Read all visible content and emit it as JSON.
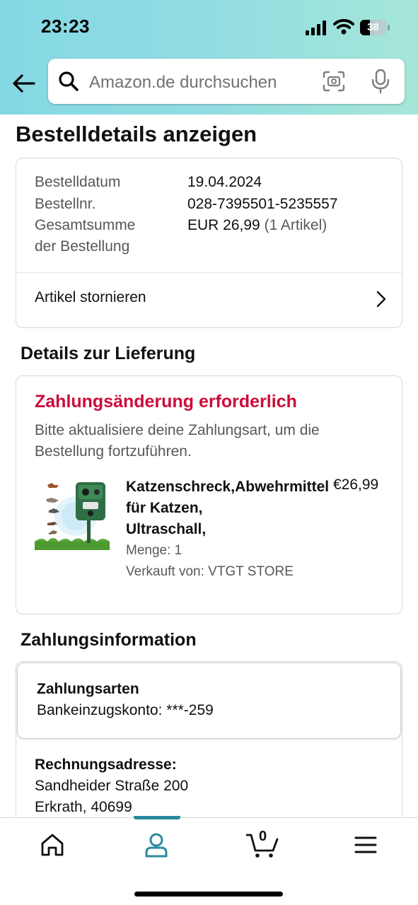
{
  "status_bar": {
    "time": "23:23",
    "battery": "38",
    "battery_level": 0.38
  },
  "search": {
    "placeholder": "Amazon.de durchsuchen"
  },
  "page": {
    "title": "Bestelldetails anzeigen"
  },
  "order_summary": {
    "rows": [
      {
        "label": "Bestelldatum",
        "value": "19.04.2024"
      },
      {
        "label": "Bestellnr.",
        "value": "028-7395501-5235557"
      },
      {
        "label": "Gesamtsumme",
        "label2": "der Bestellung",
        "value": "EUR 26,99",
        "value_extra": "(1 Artikel)"
      }
    ],
    "cancel_label": "Artikel stornieren"
  },
  "delivery": {
    "heading": "Details zur Lieferung",
    "alert_title": "Zahlungsänderung erforderlich",
    "alert_text": "Bitte aktualisiere deine Zahlungsart, um die Bestellung fortzuführen.",
    "product": {
      "name_line1": "Katzenschreck,Abwehrmittel",
      "name_line2": "für Katzen,",
      "name_line3": "Ultraschall,",
      "price": "€26,99",
      "quantity": "Menge: 1",
      "seller": "Verkauft von: VTGT STORE"
    }
  },
  "payment": {
    "heading": "Zahlungsinformation",
    "methods_label": "Zahlungsarten",
    "methods_value": "Bankeinzugskonto: ***-259",
    "billing_label": "Rechnungsadresse:",
    "billing_line1": "Sandheider Straße 200",
    "billing_line2": "Erkrath, 40699"
  },
  "nav": {
    "cart_count": "0",
    "active": "account"
  },
  "colors": {
    "alert": "#cc0c39",
    "accent": "#2b8a9e"
  }
}
